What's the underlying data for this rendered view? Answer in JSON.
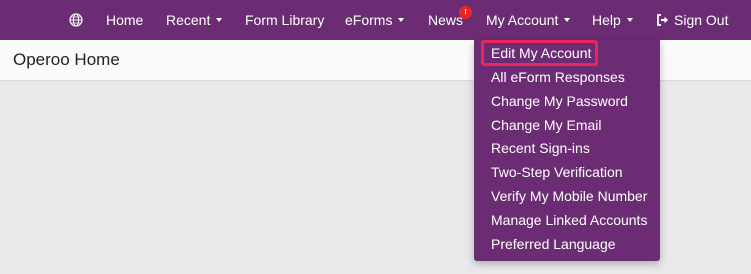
{
  "nav": {
    "home": "Home",
    "recent": "Recent",
    "form_library": "Form Library",
    "eforms": "eForms",
    "news": "News",
    "news_badge": "!",
    "my_account": "My Account",
    "help": "Help",
    "sign_out": "Sign Out"
  },
  "header": {
    "title": "Operoo Home"
  },
  "account_menu": {
    "items": [
      "Edit My Account",
      "All eForm Responses",
      "Change My Password",
      "Change My Email",
      "Recent Sign-ins",
      "Two-Step Verification",
      "Verify My Mobile Number",
      "Manage Linked Accounts",
      "Preferred Language"
    ],
    "highlighted": "Edit My Account"
  },
  "colors": {
    "brand": "#6c2c74",
    "highlight": "#e8265a",
    "badge": "#e8262a",
    "background": "#e9e9ec"
  },
  "icons": {
    "language": "globe-icon",
    "sign_out": "sign-out-icon"
  }
}
